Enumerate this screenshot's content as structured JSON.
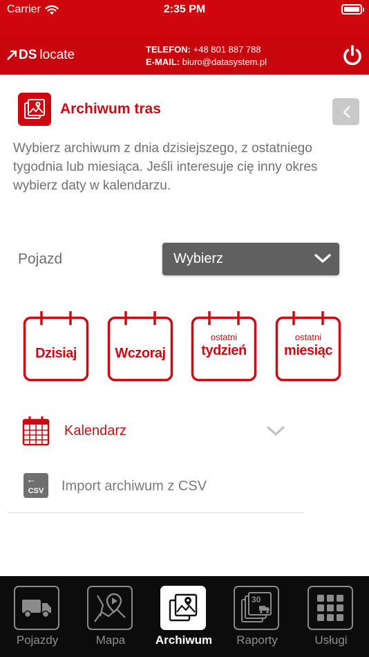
{
  "status_bar": {
    "carrier": "Carrier",
    "time": "2:35 PM"
  },
  "brand": {
    "logo_ds": "DS",
    "logo_locate": "locate",
    "phone_label": "TELEFON:",
    "phone_value": "+48 801 887 788",
    "email_label": "E-MAIL:",
    "email_value": "biuro@datasystem.pl"
  },
  "page": {
    "title": "Archiwum tras",
    "description": "Wybierz archiwum z dnia dzisiejszego, z ostatniego tygodnia lub miesiąca. Jeśli interesuje cię inny okres wybierz daty w kalendarzu."
  },
  "vehicle": {
    "label": "Pojazd",
    "selected": "Wybierz"
  },
  "quick_ranges": [
    {
      "top": "",
      "main": "Dzisiaj"
    },
    {
      "top": "",
      "main": "Wczoraj"
    },
    {
      "top": "ostatni",
      "main": "tydzień"
    },
    {
      "top": "ostatni",
      "main": "miesiąc"
    }
  ],
  "calendar": {
    "label": "Kalendarz"
  },
  "import": {
    "icon_text": "CSV",
    "label": "Import archiwum z CSV"
  },
  "tabs": [
    {
      "label": "Pojazdy",
      "icon": "truck-icon",
      "active": false
    },
    {
      "label": "Mapa",
      "icon": "map-icon",
      "active": false
    },
    {
      "label": "Archiwum",
      "icon": "archive-map-icon",
      "active": true
    },
    {
      "label": "Raporty",
      "icon": "reports-icon",
      "active": false
    },
    {
      "label": "Usługi",
      "icon": "grid-icon",
      "active": false
    }
  ],
  "colors": {
    "brand_red": "#d0060f",
    "tabbar": "#0c0c0c",
    "select_bg": "#606060"
  }
}
